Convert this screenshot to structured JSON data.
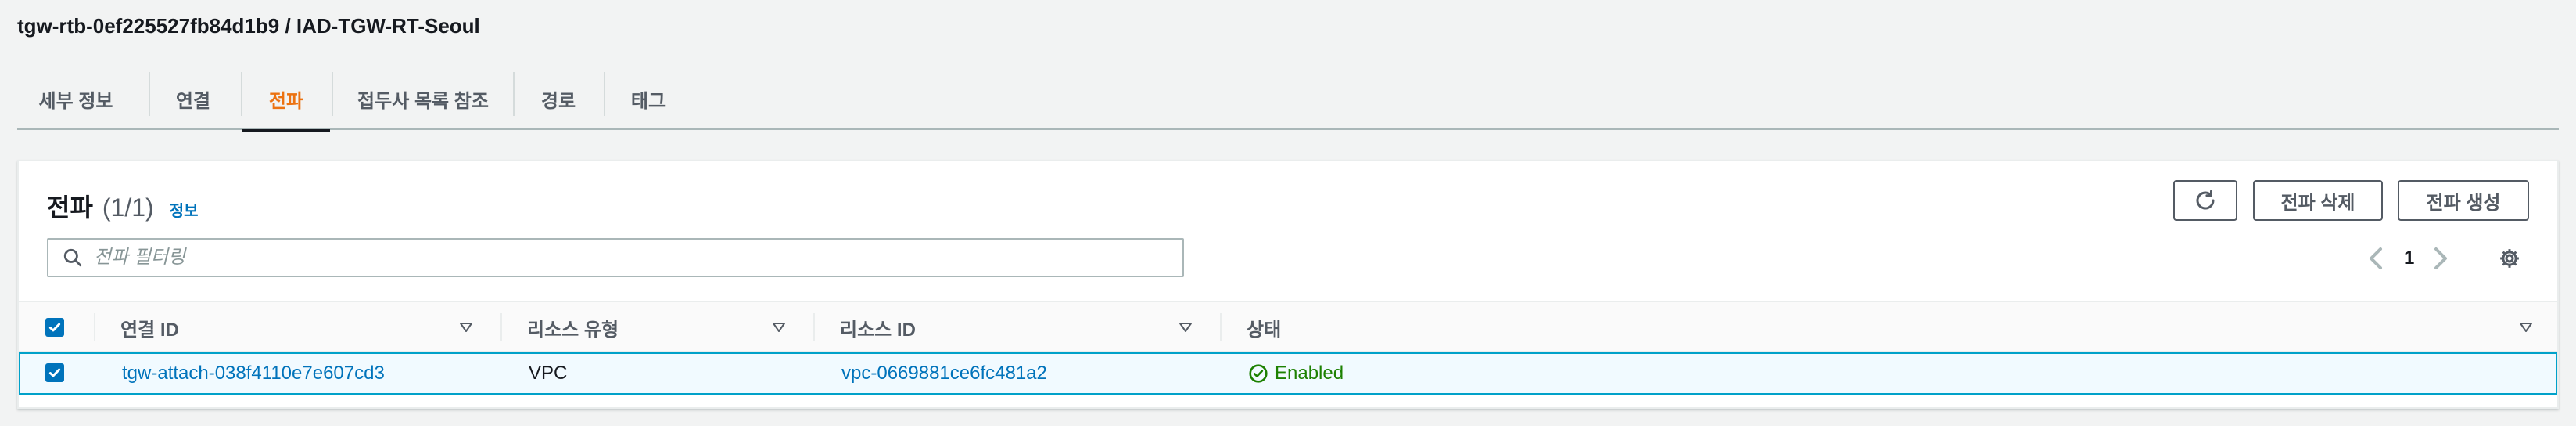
{
  "header": {
    "title": "tgw-rtb-0ef225527fb84d1b9 / IAD-TGW-RT-Seoul"
  },
  "tabs": [
    {
      "label": "세부 정보"
    },
    {
      "label": "연결"
    },
    {
      "label": "전파"
    },
    {
      "label": "접두사 목록 참조"
    },
    {
      "label": "경로"
    },
    {
      "label": "태그"
    }
  ],
  "active_tab": "전파",
  "panel": {
    "title": "전파",
    "count": "(1/1)",
    "info_link": "정보",
    "buttons": {
      "refresh_icon": "refresh-icon",
      "delete": "전파 삭제",
      "create": "전파 생성"
    },
    "search_placeholder": "전파 필터링",
    "pagination": {
      "page": "1"
    },
    "settings_icon": "gear-icon"
  },
  "table": {
    "columns": [
      "연결 ID",
      "리소스 유형",
      "리소스 ID",
      "상태"
    ],
    "rows": [
      {
        "attachment_id": "tgw-attach-038f4110e7e607cd3",
        "resource_type": "VPC",
        "resource_id": "vpc-0669881ce6fc481a2",
        "status": "Enabled",
        "selected": true
      }
    ]
  },
  "colors": {
    "accent": "#ec7211",
    "link": "#0073bb",
    "success": "#1d8102",
    "selected_border": "#00a1c9"
  }
}
